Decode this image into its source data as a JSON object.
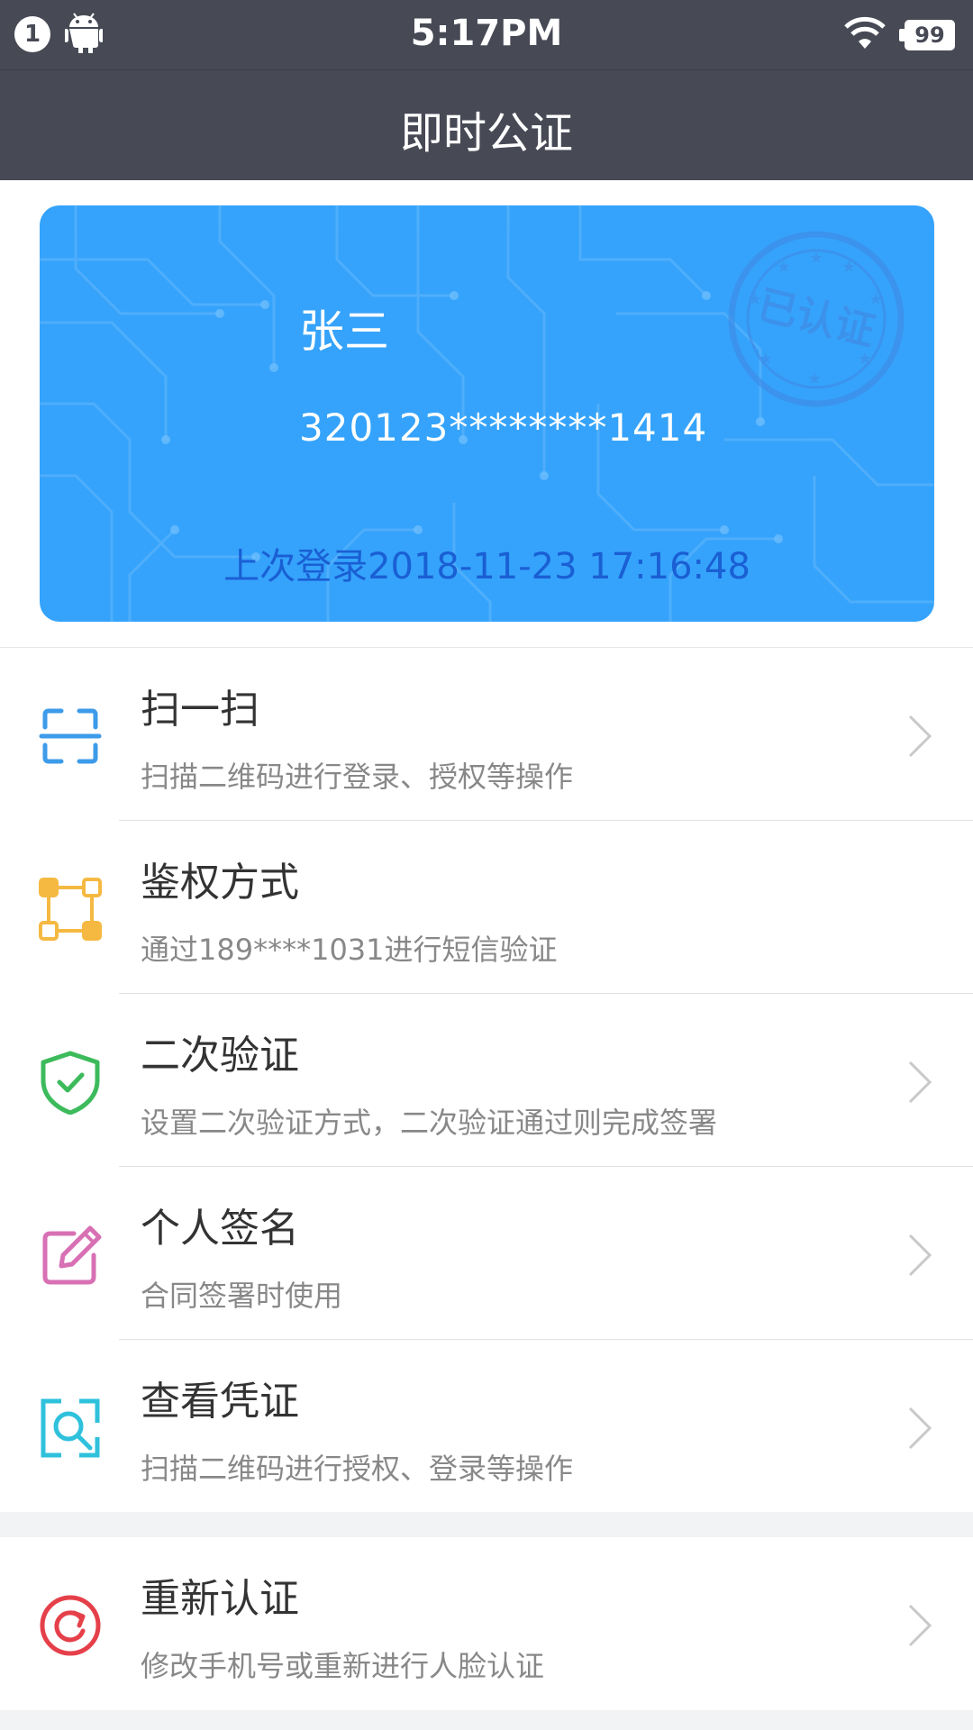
{
  "status_bar": {
    "notification_count": "1",
    "time": "5:17PM",
    "battery": "99"
  },
  "header": {
    "title": "即时公证"
  },
  "card": {
    "name": "张三",
    "id_number": "320123********1414",
    "last_login": "上次登录2018-11-23 17:16:48",
    "stamp_text": "已认证",
    "background_color": "#35a3fb"
  },
  "menu": {
    "items": [
      {
        "label": "扫一扫",
        "desc": "扫描二维码进行登录、授权等操作",
        "icon": "scan-icon",
        "color": "#3d9be9",
        "has_chevron": true
      },
      {
        "label": "鉴权方式",
        "desc": "通过189****1031进行短信验证",
        "icon": "auth-method-icon",
        "color": "#f5b942",
        "has_chevron": false
      },
      {
        "label": "二次验证",
        "desc": "设置二次验证方式，二次验证通过则完成签署",
        "icon": "shield-check-icon",
        "color": "#3dbb5c",
        "has_chevron": true
      },
      {
        "label": "个人签名",
        "desc": "合同签署时使用",
        "icon": "edit-signature-icon",
        "color": "#d870b4",
        "has_chevron": true
      },
      {
        "label": "查看凭证",
        "desc": "扫描二维码进行授权、登录等操作",
        "icon": "view-certificate-icon",
        "color": "#2fc1dc",
        "has_chevron": true
      }
    ],
    "reauth": {
      "label": "重新认证",
      "desc": "修改手机号或重新进行人脸认证",
      "icon": "refresh-icon",
      "color": "#e5404a",
      "has_chevron": true
    }
  }
}
